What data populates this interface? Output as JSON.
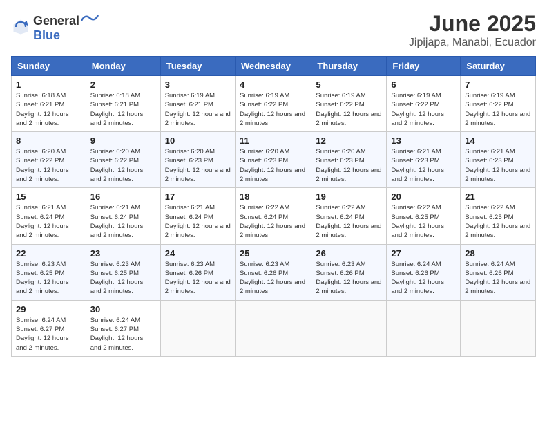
{
  "header": {
    "logo_general": "General",
    "logo_blue": "Blue",
    "month_title": "June 2025",
    "location": "Jipijapa, Manabi, Ecuador"
  },
  "columns": [
    "Sunday",
    "Monday",
    "Tuesday",
    "Wednesday",
    "Thursday",
    "Friday",
    "Saturday"
  ],
  "weeks": [
    [
      {
        "day": "1",
        "sunrise": "6:18 AM",
        "sunset": "6:21 PM",
        "daylight": "12 hours and 2 minutes."
      },
      {
        "day": "2",
        "sunrise": "6:18 AM",
        "sunset": "6:21 PM",
        "daylight": "12 hours and 2 minutes."
      },
      {
        "day": "3",
        "sunrise": "6:19 AM",
        "sunset": "6:21 PM",
        "daylight": "12 hours and 2 minutes."
      },
      {
        "day": "4",
        "sunrise": "6:19 AM",
        "sunset": "6:22 PM",
        "daylight": "12 hours and 2 minutes."
      },
      {
        "day": "5",
        "sunrise": "6:19 AM",
        "sunset": "6:22 PM",
        "daylight": "12 hours and 2 minutes."
      },
      {
        "day": "6",
        "sunrise": "6:19 AM",
        "sunset": "6:22 PM",
        "daylight": "12 hours and 2 minutes."
      },
      {
        "day": "7",
        "sunrise": "6:19 AM",
        "sunset": "6:22 PM",
        "daylight": "12 hours and 2 minutes."
      }
    ],
    [
      {
        "day": "8",
        "sunrise": "6:20 AM",
        "sunset": "6:22 PM",
        "daylight": "12 hours and 2 minutes."
      },
      {
        "day": "9",
        "sunrise": "6:20 AM",
        "sunset": "6:22 PM",
        "daylight": "12 hours and 2 minutes."
      },
      {
        "day": "10",
        "sunrise": "6:20 AM",
        "sunset": "6:23 PM",
        "daylight": "12 hours and 2 minutes."
      },
      {
        "day": "11",
        "sunrise": "6:20 AM",
        "sunset": "6:23 PM",
        "daylight": "12 hours and 2 minutes."
      },
      {
        "day": "12",
        "sunrise": "6:20 AM",
        "sunset": "6:23 PM",
        "daylight": "12 hours and 2 minutes."
      },
      {
        "day": "13",
        "sunrise": "6:21 AM",
        "sunset": "6:23 PM",
        "daylight": "12 hours and 2 minutes."
      },
      {
        "day": "14",
        "sunrise": "6:21 AM",
        "sunset": "6:23 PM",
        "daylight": "12 hours and 2 minutes."
      }
    ],
    [
      {
        "day": "15",
        "sunrise": "6:21 AM",
        "sunset": "6:24 PM",
        "daylight": "12 hours and 2 minutes."
      },
      {
        "day": "16",
        "sunrise": "6:21 AM",
        "sunset": "6:24 PM",
        "daylight": "12 hours and 2 minutes."
      },
      {
        "day": "17",
        "sunrise": "6:21 AM",
        "sunset": "6:24 PM",
        "daylight": "12 hours and 2 minutes."
      },
      {
        "day": "18",
        "sunrise": "6:22 AM",
        "sunset": "6:24 PM",
        "daylight": "12 hours and 2 minutes."
      },
      {
        "day": "19",
        "sunrise": "6:22 AM",
        "sunset": "6:24 PM",
        "daylight": "12 hours and 2 minutes."
      },
      {
        "day": "20",
        "sunrise": "6:22 AM",
        "sunset": "6:25 PM",
        "daylight": "12 hours and 2 minutes."
      },
      {
        "day": "21",
        "sunrise": "6:22 AM",
        "sunset": "6:25 PM",
        "daylight": "12 hours and 2 minutes."
      }
    ],
    [
      {
        "day": "22",
        "sunrise": "6:23 AM",
        "sunset": "6:25 PM",
        "daylight": "12 hours and 2 minutes."
      },
      {
        "day": "23",
        "sunrise": "6:23 AM",
        "sunset": "6:25 PM",
        "daylight": "12 hours and 2 minutes."
      },
      {
        "day": "24",
        "sunrise": "6:23 AM",
        "sunset": "6:26 PM",
        "daylight": "12 hours and 2 minutes."
      },
      {
        "day": "25",
        "sunrise": "6:23 AM",
        "sunset": "6:26 PM",
        "daylight": "12 hours and 2 minutes."
      },
      {
        "day": "26",
        "sunrise": "6:23 AM",
        "sunset": "6:26 PM",
        "daylight": "12 hours and 2 minutes."
      },
      {
        "day": "27",
        "sunrise": "6:24 AM",
        "sunset": "6:26 PM",
        "daylight": "12 hours and 2 minutes."
      },
      {
        "day": "28",
        "sunrise": "6:24 AM",
        "sunset": "6:26 PM",
        "daylight": "12 hours and 2 minutes."
      }
    ],
    [
      {
        "day": "29",
        "sunrise": "6:24 AM",
        "sunset": "6:27 PM",
        "daylight": "12 hours and 2 minutes."
      },
      {
        "day": "30",
        "sunrise": "6:24 AM",
        "sunset": "6:27 PM",
        "daylight": "12 hours and 2 minutes."
      },
      null,
      null,
      null,
      null,
      null
    ]
  ]
}
